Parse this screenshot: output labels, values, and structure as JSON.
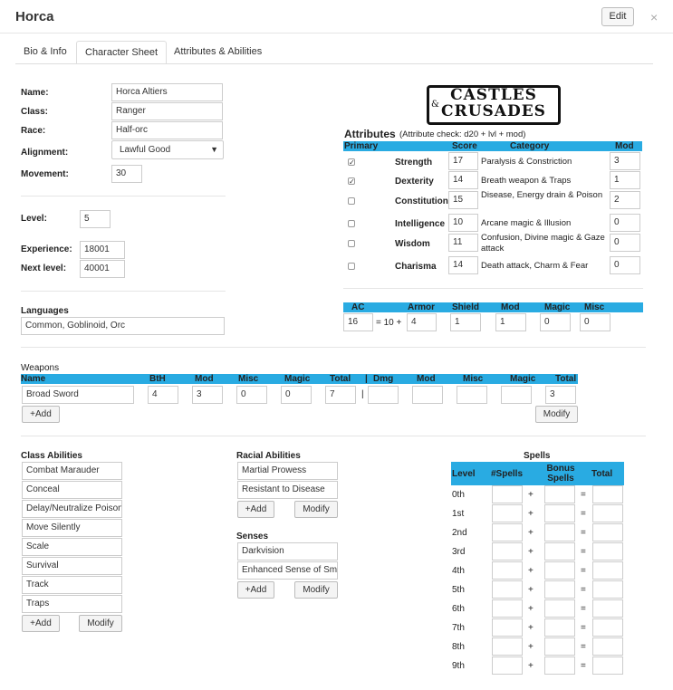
{
  "header": {
    "title": "Horca",
    "edit_label": "Edit",
    "close_glyph": "×"
  },
  "tabs": [
    {
      "label": "Bio & Info"
    },
    {
      "label": "Character Sheet"
    },
    {
      "label": "Attributes & Abilities"
    }
  ],
  "bio": {
    "name_label": "Name:",
    "name": "Horca Altiers",
    "class_label": "Class:",
    "class": "Ranger",
    "race_label": "Race:",
    "race": "Half-orc",
    "alignment_label": "Alignment:",
    "alignment": "Lawful Good",
    "movement_label": "Movement:",
    "movement": "30",
    "level_label": "Level:",
    "level": "5",
    "experience_label": "Experience:",
    "experience": "18001",
    "next_level_label": "Next level:",
    "next_level": "40001",
    "languages_label": "Languages",
    "languages": "Common, Goblinoid, Orc"
  },
  "logo": {
    "line1": "CASTLES",
    "amp": "&",
    "line2": "CRUSADES"
  },
  "attributes": {
    "title": "Attributes",
    "note": "(Attribute check: d20 + lvl + mod)",
    "headers": {
      "primary": "Primary",
      "score": "Score",
      "category": "Category",
      "mod": "Mod"
    },
    "rows": [
      {
        "name": "Strength",
        "primary": true,
        "score": "17",
        "category": "Paralysis & Constriction",
        "mod": "3"
      },
      {
        "name": "Dexterity",
        "primary": true,
        "score": "14",
        "category": "Breath weapon & Traps",
        "mod": "1"
      },
      {
        "name": "Constitution",
        "primary": false,
        "score": "15",
        "category": "Disease, Energy drain & Poison",
        "mod": "2"
      },
      {
        "name": "Intelligence",
        "primary": false,
        "score": "10",
        "category": "Arcane magic & Illusion",
        "mod": "0"
      },
      {
        "name": "Wisdom",
        "primary": false,
        "score": "11",
        "category": "Confusion, Divine magic & Gaze attack",
        "mod": "0"
      },
      {
        "name": "Charisma",
        "primary": false,
        "score": "14",
        "category": "Death attack, Charm & Fear",
        "mod": "0"
      }
    ]
  },
  "ac": {
    "headers": {
      "ac": "AC",
      "armor": "Armor",
      "shield": "Shield",
      "mod": "Mod",
      "magic": "Magic",
      "misc": "Misc"
    },
    "ac": "16",
    "eq": "= 10 +",
    "armor": "4",
    "shield": "1",
    "mod": "1",
    "magic": "0",
    "misc": "0"
  },
  "weapons": {
    "title": "Weapons",
    "headers": {
      "name": "Name",
      "bth": "BtH",
      "mod": "Mod",
      "misc": "Misc",
      "magic": "Magic",
      "total": "Total",
      "sep": "|",
      "dmg": "Dmg",
      "dmod": "Mod",
      "dmisc": "Misc",
      "dmagic": "Magic",
      "dtotal": "Total"
    },
    "rows": [
      {
        "name": "Broad Sword",
        "bth": "4",
        "mod": "3",
        "misc": "0",
        "magic": "0",
        "total": "7",
        "sep": "|",
        "dmg": "",
        "dmod": "",
        "dmisc": "",
        "dmagic": "",
        "dtotal": "3"
      }
    ],
    "add_label": "+Add",
    "modify_label": "Modify"
  },
  "class_abilities": {
    "title": "Class Abilities",
    "items": [
      "Combat Marauder",
      "Conceal",
      "Delay/Neutralize Poison",
      "Move Silently",
      "Scale",
      "Survival",
      "Track",
      "Traps"
    ],
    "add_label": "+Add",
    "modify_label": "Modify"
  },
  "racial_abilities": {
    "title": "Racial Abilities",
    "items": [
      "Martial Prowess",
      "Resistant to Disease"
    ],
    "add_label": "+Add",
    "modify_label": "Modify"
  },
  "senses": {
    "title": "Senses",
    "items": [
      "Darkvision",
      "Enhanced Sense of Smell"
    ],
    "add_label": "+Add",
    "modify_label": "Modify"
  },
  "spells": {
    "title": "Spells",
    "headers": {
      "level": "Level",
      "spells": "#Spells",
      "bonus": "Bonus Spells",
      "total": "Total"
    },
    "levels": [
      "0th",
      "1st",
      "2nd",
      "3rd",
      "4th",
      "5th",
      "6th",
      "7th",
      "8th",
      "9th"
    ],
    "plus": "+",
    "eq": "="
  }
}
